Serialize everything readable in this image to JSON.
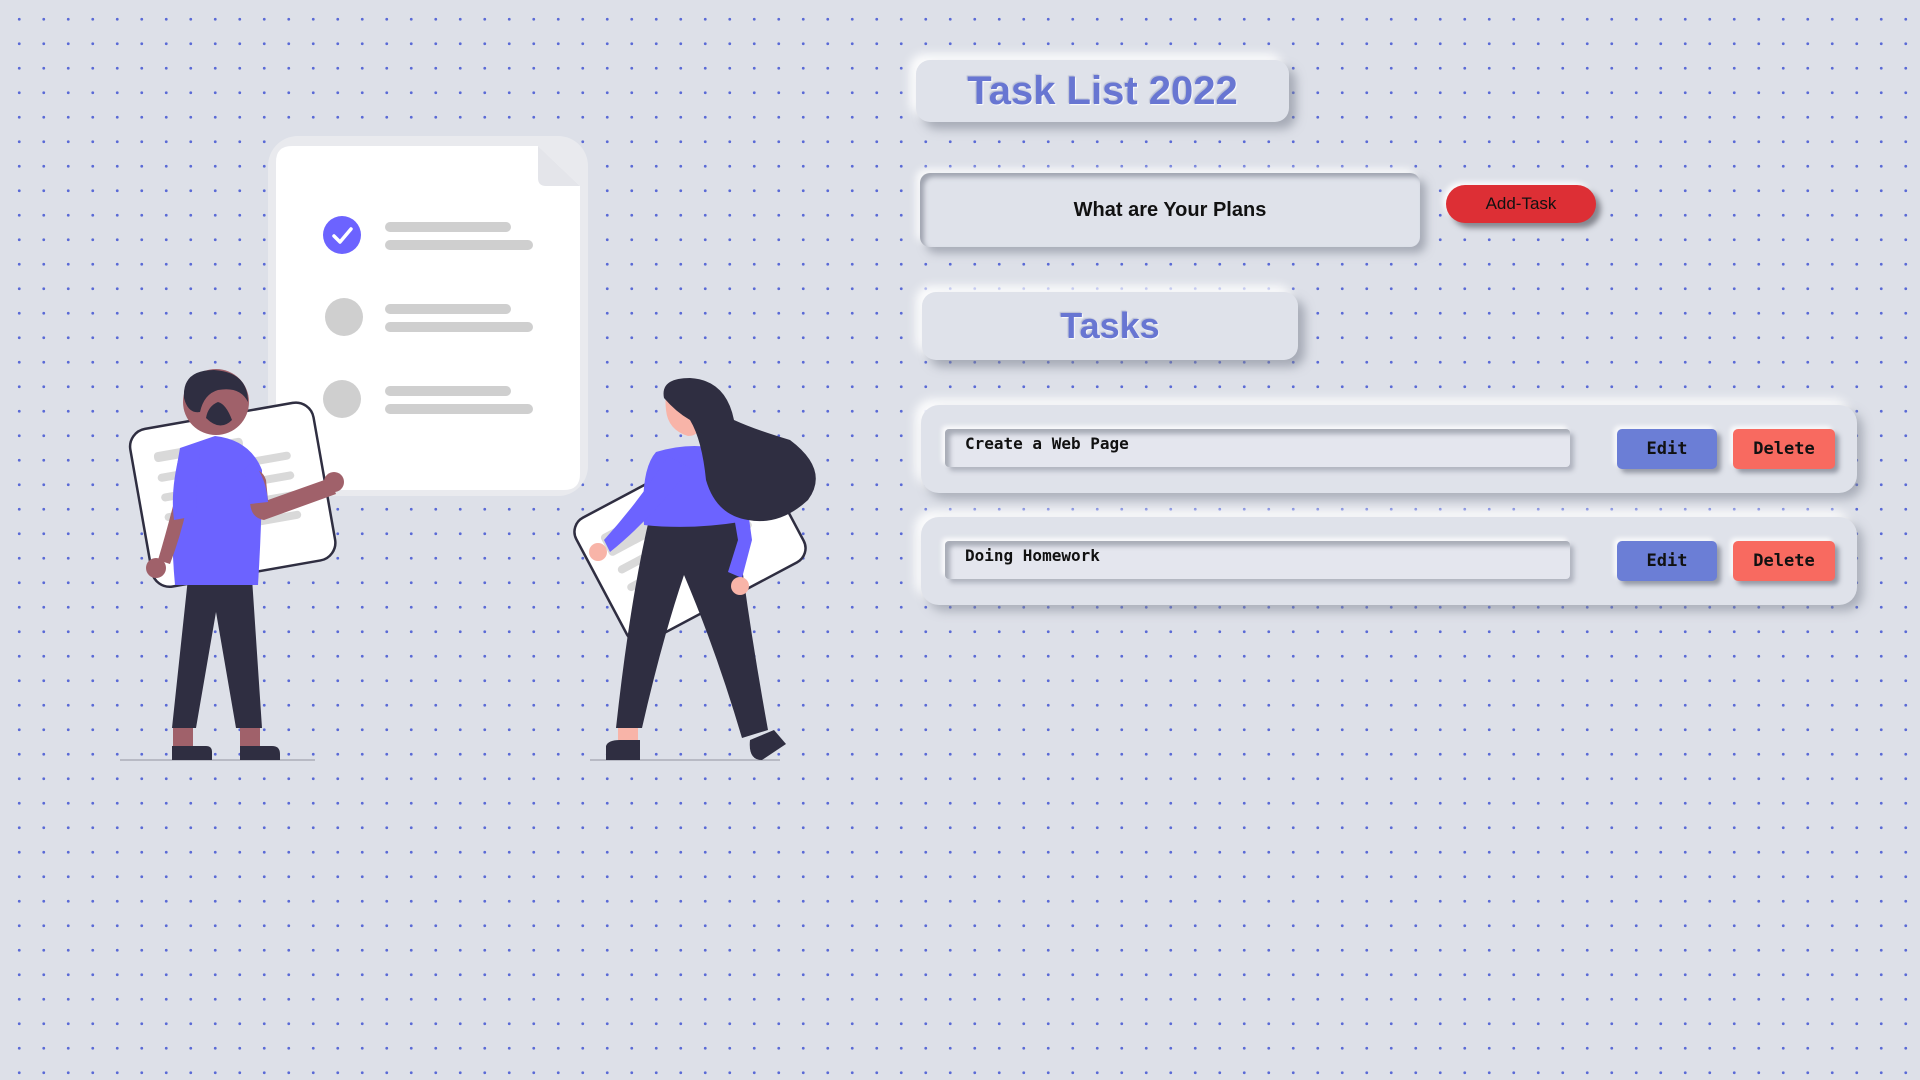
{
  "header": {
    "title": "Task List 2022"
  },
  "form": {
    "input_placeholder": "What are Your Plans",
    "add_label": "Add-Task"
  },
  "tasks_section": {
    "title": "Tasks"
  },
  "tasks": [
    {
      "text": "Create a Web Page",
      "edit_label": "Edit",
      "delete_label": "Delete"
    },
    {
      "text": "Doing Homework",
      "edit_label": "Edit",
      "delete_label": "Delete"
    }
  ],
  "illustration": {
    "icon": "people-with-checklist-illustration"
  },
  "colors": {
    "background": "#dde0e8",
    "accent": "#6876d2",
    "add_button": "#dd2f35",
    "edit_button": "#6b7ed6",
    "delete_button": "#f86a60",
    "checkmark": "#6c63ff"
  }
}
